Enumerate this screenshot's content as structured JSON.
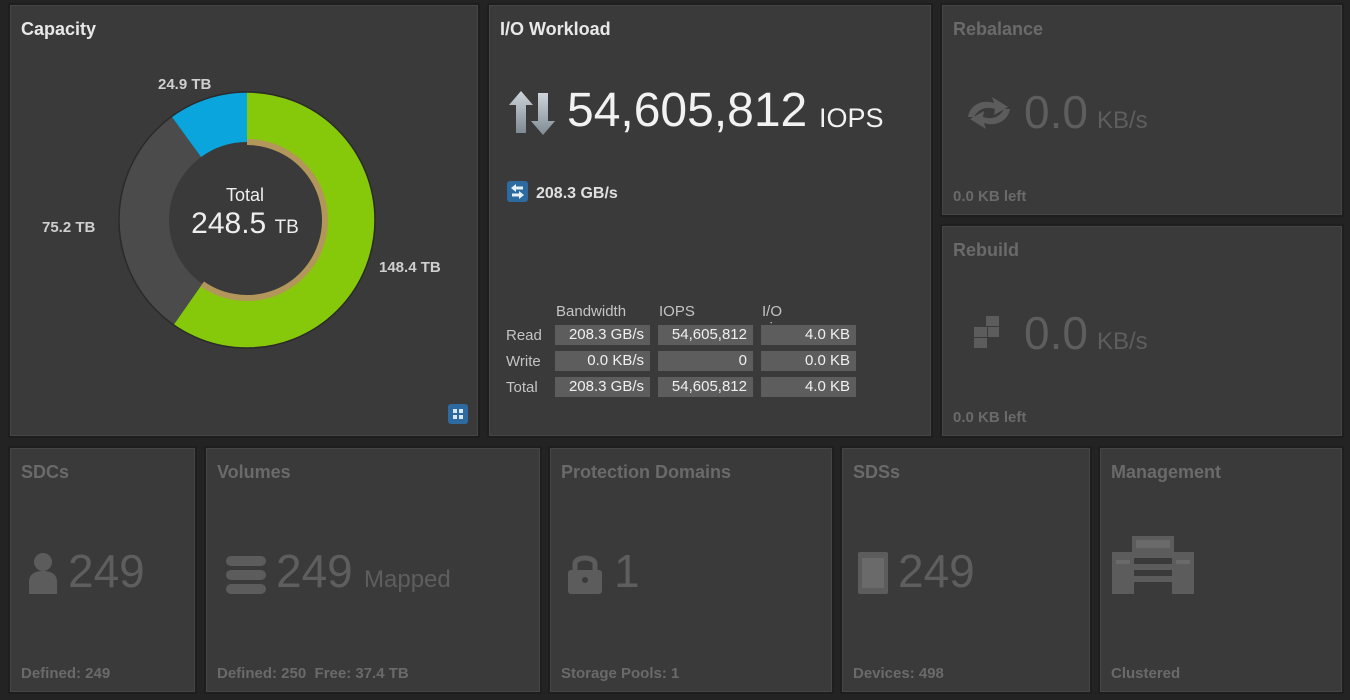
{
  "capacity": {
    "title": "Capacity",
    "total_caption": "Total",
    "total_value": "248.5",
    "total_unit": "TB",
    "segments": [
      {
        "label": "148.4 TB",
        "value": 148.4,
        "color": "#86c80a"
      },
      {
        "label": "75.2 TB",
        "value": 75.2,
        "color": "#4b4b4b"
      },
      {
        "label": "24.9 TB",
        "value": 24.9,
        "color": "#0aa5dc"
      }
    ],
    "inner_ring_color": "#b3975a"
  },
  "io": {
    "title": "I/O Workload",
    "iops": "54,605,812",
    "iops_unit": "IOPS",
    "bandwidth": "208.3 GB/s",
    "table": {
      "headers": [
        "Bandwidth",
        "IOPS",
        "I/O size"
      ],
      "rows": [
        {
          "label": "Read",
          "bandwidth": "208.3 GB/s",
          "iops": "54,605,812",
          "size": "4.0 KB"
        },
        {
          "label": "Write",
          "bandwidth": "0.0 KB/s",
          "iops": "0",
          "size": "0.0 KB"
        },
        {
          "label": "Total",
          "bandwidth": "208.3 GB/s",
          "iops": "54,605,812",
          "size": "4.0 KB"
        }
      ]
    }
  },
  "rebalance": {
    "title": "Rebalance",
    "value": "0.0",
    "unit": "KB/s",
    "footer": "0.0 KB left"
  },
  "rebuild": {
    "title": "Rebuild",
    "value": "0.0",
    "unit": "KB/s",
    "footer": "0.0 KB left"
  },
  "sdcs": {
    "title": "SDCs",
    "count": "249",
    "footer": "Defined: 249"
  },
  "volumes": {
    "title": "Volumes",
    "count": "249",
    "unit": "Mapped",
    "footer": "Defined: 250  Free: 37.4 TB"
  },
  "protection_domains": {
    "title": "Protection Domains",
    "count": "1",
    "footer": "Storage Pools: 1"
  },
  "sdss": {
    "title": "SDSs",
    "count": "249",
    "footer": "Devices: 498"
  },
  "management": {
    "title": "Management",
    "footer": "Clustered"
  }
}
